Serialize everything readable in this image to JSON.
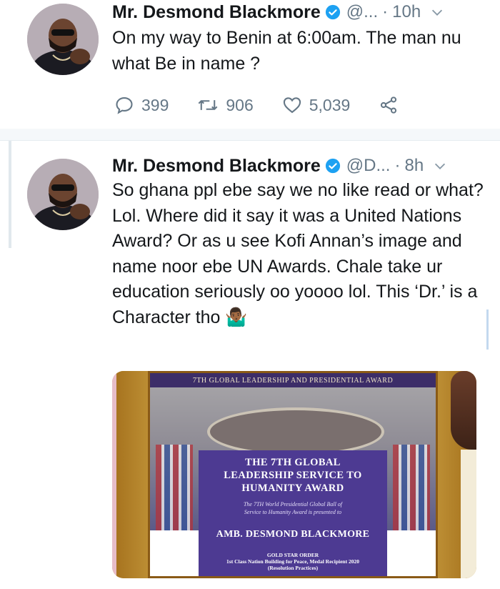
{
  "tweets": [
    {
      "author": "Mr. Desmond Blackmore",
      "handle": "@...",
      "separator": "·",
      "time": "10h",
      "text": "On my way to Benin at 6:00am. The man nu what Be in name ?",
      "replies": "399",
      "retweets": "906",
      "likes": "5,039"
    },
    {
      "author": "Mr. Desmond Blackmore",
      "handle": "@D...",
      "separator": "·",
      "time": "8h",
      "text": "So ghana ppl ebe say we no like read or what? Lol. Where did it say it was a United Nations Award? Or as u see Kofi Annan’s image and name noor ebe UN Awards. Chale take ur education seriously oo yoooo lol. This ‘Dr.’ is a Character tho 🤷🏾‍♂️",
      "photo": {
        "banner": "7TH GLOBAL LEADERSHIP AND PRESIDENTIAL AWARD",
        "award_title": "THE 7TH GLOBAL\nLEADERSHIP SERVICE TO\nHUMANITY AWARD",
        "award_sub": "The 7TH World Presidential Global Ball of\nService to Humanity Award is presented to",
        "recipient": "AMB. DESMOND BLACKMORE",
        "order": "GOLD STAR ORDER\n1st Class Nation Building for Peace, Medal Recipient 2020\n(Resolution Practices)"
      }
    }
  ],
  "icons": {
    "verified": "verified-badge-icon",
    "caret": "chevron-down-icon",
    "reply": "reply-icon",
    "retweet": "retweet-icon",
    "like": "heart-icon",
    "share": "share-icon"
  },
  "colors": {
    "verified": "#1da1f2",
    "text": "#14171a",
    "secondary": "#657786",
    "background": "#f5f8fa"
  }
}
